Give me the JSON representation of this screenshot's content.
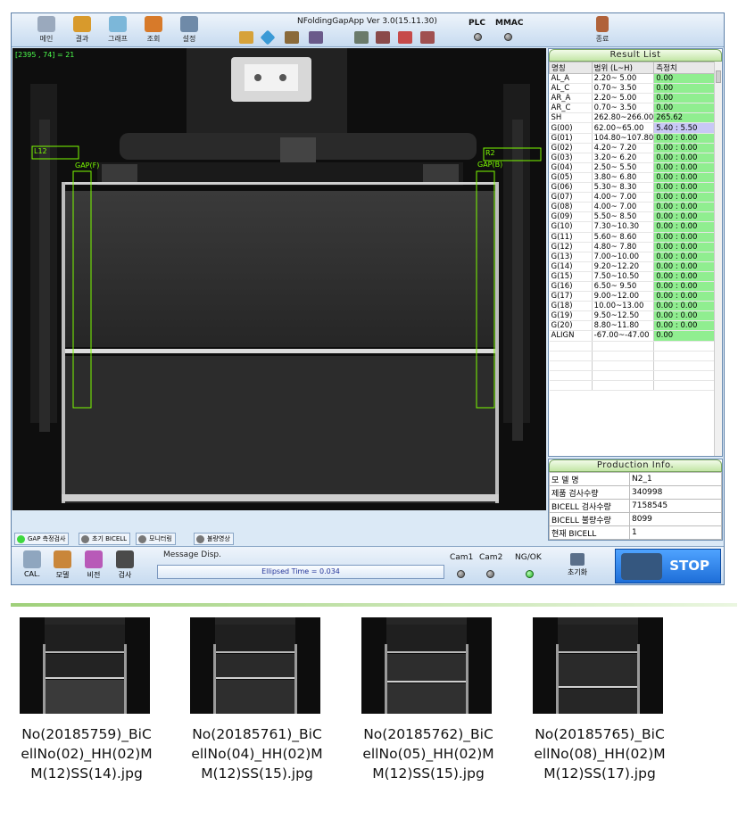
{
  "app": {
    "title": "NFoldingGapApp Ver 3.0(15.11.30)",
    "toolbar_buttons": [
      {
        "label": "메인",
        "icon": "main-icon"
      },
      {
        "label": "결과",
        "icon": "result-icon"
      },
      {
        "label": "그래프",
        "icon": "graph-icon"
      },
      {
        "label": "조회",
        "icon": "search-icon"
      },
      {
        "label": "설정",
        "icon": "settings-icon"
      }
    ],
    "exit_label": "종료",
    "plc_label": "PLC",
    "mmac_label": "MMAC"
  },
  "camera": {
    "coord": "[2395 , 74] = 21",
    "roi_left_label": "L12",
    "roi_left_gap": "GAP(F)",
    "roi_right_label": "R2",
    "roi_right_gap": "GAP(B)"
  },
  "result_list": {
    "title": "Result List",
    "headers": [
      "명칭",
      "범위 (L~H)",
      "측정치"
    ],
    "rows": [
      {
        "name": "AL_A",
        "range": "2.20~ 5.00",
        "value": "0.00"
      },
      {
        "name": "AL_C",
        "range": "0.70~ 3.50",
        "value": "0.00"
      },
      {
        "name": "AR_A",
        "range": "2.20~ 5.00",
        "value": "0.00"
      },
      {
        "name": "AR_C",
        "range": "0.70~ 3.50",
        "value": "0.00"
      },
      {
        "name": "SH",
        "range": "262.80~266.00",
        "value": "265.62"
      },
      {
        "name": "G(00)",
        "range": "62.00~65.00",
        "value": "5.40 : 5.50"
      },
      {
        "name": "G(01)",
        "range": "104.80~107.80",
        "value": "0.00 : 0.00"
      },
      {
        "name": "G(02)",
        "range": "4.20~ 7.20",
        "value": "0.00 : 0.00"
      },
      {
        "name": "G(03)",
        "range": "3.20~ 6.20",
        "value": "0.00 : 0.00"
      },
      {
        "name": "G(04)",
        "range": "2.50~ 5.50",
        "value": "0.00 : 0.00"
      },
      {
        "name": "G(05)",
        "range": "3.80~ 6.80",
        "value": "0.00 : 0.00"
      },
      {
        "name": "G(06)",
        "range": "5.30~ 8.30",
        "value": "0.00 : 0.00"
      },
      {
        "name": "G(07)",
        "range": "4.00~ 7.00",
        "value": "0.00 : 0.00"
      },
      {
        "name": "G(08)",
        "range": "4.00~ 7.00",
        "value": "0.00 : 0.00"
      },
      {
        "name": "G(09)",
        "range": "5.50~ 8.50",
        "value": "0.00 : 0.00"
      },
      {
        "name": "G(10)",
        "range": "7.30~10.30",
        "value": "0.00 : 0.00"
      },
      {
        "name": "G(11)",
        "range": "5.60~ 8.60",
        "value": "0.00 : 0.00"
      },
      {
        "name": "G(12)",
        "range": "4.80~ 7.80",
        "value": "0.00 : 0.00"
      },
      {
        "name": "G(13)",
        "range": "7.00~10.00",
        "value": "0.00 : 0.00"
      },
      {
        "name": "G(14)",
        "range": "9.20~12.20",
        "value": "0.00 : 0.00"
      },
      {
        "name": "G(15)",
        "range": "7.50~10.50",
        "value": "0.00 : 0.00"
      },
      {
        "name": "G(16)",
        "range": "6.50~ 9.50",
        "value": "0.00 : 0.00"
      },
      {
        "name": "G(17)",
        "range": "9.00~12.00",
        "value": "0.00 : 0.00"
      },
      {
        "name": "G(18)",
        "range": "10.00~13.00",
        "value": "0.00 : 0.00"
      },
      {
        "name": "G(19)",
        "range": "9.50~12.50",
        "value": "0.00 : 0.00"
      },
      {
        "name": "G(20)",
        "range": "8.80~11.80",
        "value": "0.00 : 0.00"
      },
      {
        "name": "ALIGN",
        "range": "-67.00~-47.00",
        "value": "0.00"
      }
    ]
  },
  "production_info": {
    "title": "Production Info.",
    "rows": [
      {
        "label": "모 델 명",
        "value": "N2_1"
      },
      {
        "label": "제품 검사수량",
        "value": "340998"
      },
      {
        "label": "BICELL 검사수량",
        "value": "7158545"
      },
      {
        "label": "BICELL 불량수량",
        "value": "8099"
      },
      {
        "label": "현재 BICELL",
        "value": "1"
      }
    ]
  },
  "tabs": [
    {
      "label": "GAP 측정검사",
      "active": true
    },
    {
      "label": "초기 BICELL",
      "active": false
    },
    {
      "label": "모니터링",
      "active": false
    },
    {
      "label": "불량영상",
      "active": false
    }
  ],
  "bottom": {
    "buttons": [
      {
        "label": "CAL."
      },
      {
        "label": "모델"
      },
      {
        "label": "비전"
      },
      {
        "label": "검사"
      }
    ],
    "message_title": "Message Disp.",
    "message_text": "Ellipsed Time = 0.034",
    "cam1_label": "Cam1",
    "cam2_label": "Cam2",
    "ngok_label": "NG/OK",
    "reset_label": "초기화",
    "stop_label": "STOP"
  },
  "files": [
    {
      "name": "No(20185759)_BiCellNo(02)_HH(02)MM(12)SS(14).jpg"
    },
    {
      "name": "No(20185761)_BiCellNo(04)_HH(02)MM(12)SS(15).jpg"
    },
    {
      "name": "No(20185762)_BiCellNo(05)_HH(02)MM(12)SS(15).jpg"
    },
    {
      "name": "No(20185765)_BiCellNo(08)_HH(02)MM(12)SS(17).jpg"
    }
  ],
  "colors": {
    "ok_green": "#90ee90",
    "highlight_lavender": "#c8c8f5",
    "stop_blue": "#1e6ed8",
    "roi_green": "#7cfc00"
  }
}
